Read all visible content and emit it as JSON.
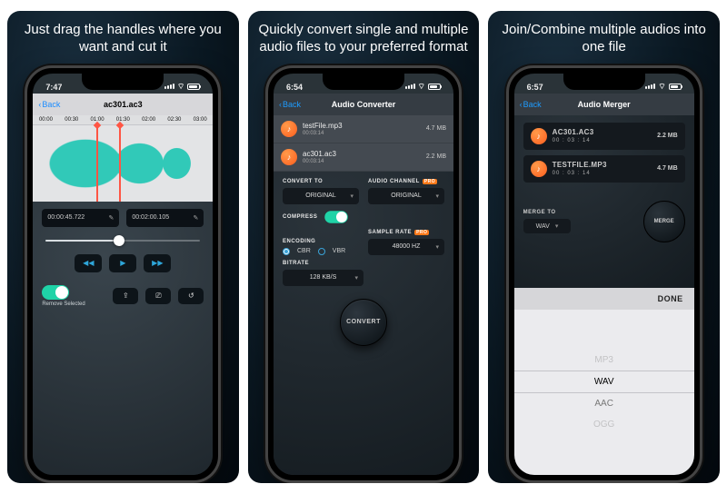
{
  "shot1": {
    "caption": "Just drag the handles where you want and cut it",
    "time": "7:47",
    "back": "Back",
    "title": "ac301.ac3",
    "ruler": [
      "00:00",
      "00:30",
      "01:00",
      "01:30",
      "02:00",
      "02:30",
      "03:00"
    ],
    "startTime": "00:00:45.722",
    "endTime": "00:02:00.105",
    "removeLabel": "Remove Selected"
  },
  "shot2": {
    "caption": "Quickly convert single and multiple audio files to your preferred format",
    "time": "6:54",
    "back": "Back",
    "title": "Audio Converter",
    "files": [
      {
        "name": "testFile.mp3",
        "dur": "00:03:14",
        "size": "4.7 MB"
      },
      {
        "name": "ac301.ac3",
        "dur": "00:03:14",
        "size": "2.2 MB"
      }
    ],
    "labels": {
      "convertTo": "CONVERT TO",
      "audioChannel": "AUDIO CHANNEL",
      "compress": "COMPRESS",
      "encoding": "ENCODING",
      "sampleRate": "SAMPLE RATE",
      "bitrate": "BITRATE",
      "pro": "PRO"
    },
    "values": {
      "convertTo": "ORIGINAL",
      "audioChannel": "ORIGINAL",
      "encodingCBR": "CBR",
      "encodingVBR": "VBR",
      "sampleRate": "48000 HZ",
      "bitrate": "128 KB/S"
    },
    "convertBtn": "CONVERT"
  },
  "shot3": {
    "caption": "Join/Combine multiple audios into one file",
    "time": "6:57",
    "back": "Back",
    "title": "Audio Merger",
    "files": [
      {
        "name": "AC301.AC3",
        "dur": "00 : 03 : 14",
        "size": "2.2 MB"
      },
      {
        "name": "TESTFILE.MP3",
        "dur": "00 : 03 : 14",
        "size": "4.7 MB"
      }
    ],
    "mergeToLabel": "MERGE TO",
    "mergeToValue": "WAV",
    "mergeBtn": "MERGE",
    "done": "DONE",
    "picker": [
      "MP3",
      "WAV",
      "AAC",
      "OGG"
    ]
  }
}
